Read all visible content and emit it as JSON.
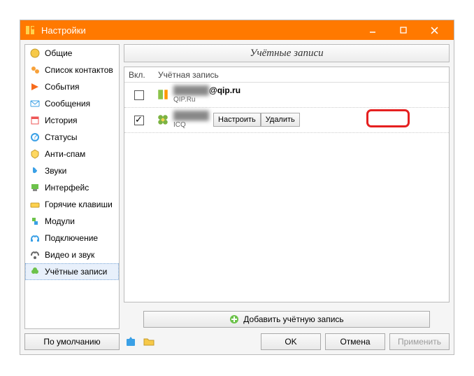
{
  "window": {
    "title": "Настройки"
  },
  "sidebar": {
    "items": [
      {
        "label": "Общие"
      },
      {
        "label": "Список контактов"
      },
      {
        "label": "События"
      },
      {
        "label": "Сообщения"
      },
      {
        "label": "История"
      },
      {
        "label": "Статусы"
      },
      {
        "label": "Анти-спам"
      },
      {
        "label": "Звуки"
      },
      {
        "label": "Интерфейс"
      },
      {
        "label": "Горячие клавиши"
      },
      {
        "label": "Модули"
      },
      {
        "label": "Подключение"
      },
      {
        "label": "Видео и звук"
      },
      {
        "label": "Учётные записи"
      }
    ],
    "default_btn": "По умолчанию"
  },
  "main": {
    "header": "Учётные записи",
    "cols": {
      "enabled": "Вкл.",
      "account": "Учётная запись"
    },
    "rows": [
      {
        "checked": false,
        "name_prefix_hidden": "██████",
        "name_suffix": "@qip.ru",
        "service": "QIP.Ru",
        "icon": "qip"
      },
      {
        "checked": true,
        "name_prefix_hidden": "██████",
        "name_suffix": "",
        "service": "ICQ",
        "icon": "icq"
      }
    ],
    "row_actions": {
      "configure": "Настроить",
      "delete": "Удалить"
    },
    "add_btn": "Добавить учётную запись"
  },
  "footer": {
    "ok": "OK",
    "cancel": "Отмена",
    "apply": "Применить"
  }
}
